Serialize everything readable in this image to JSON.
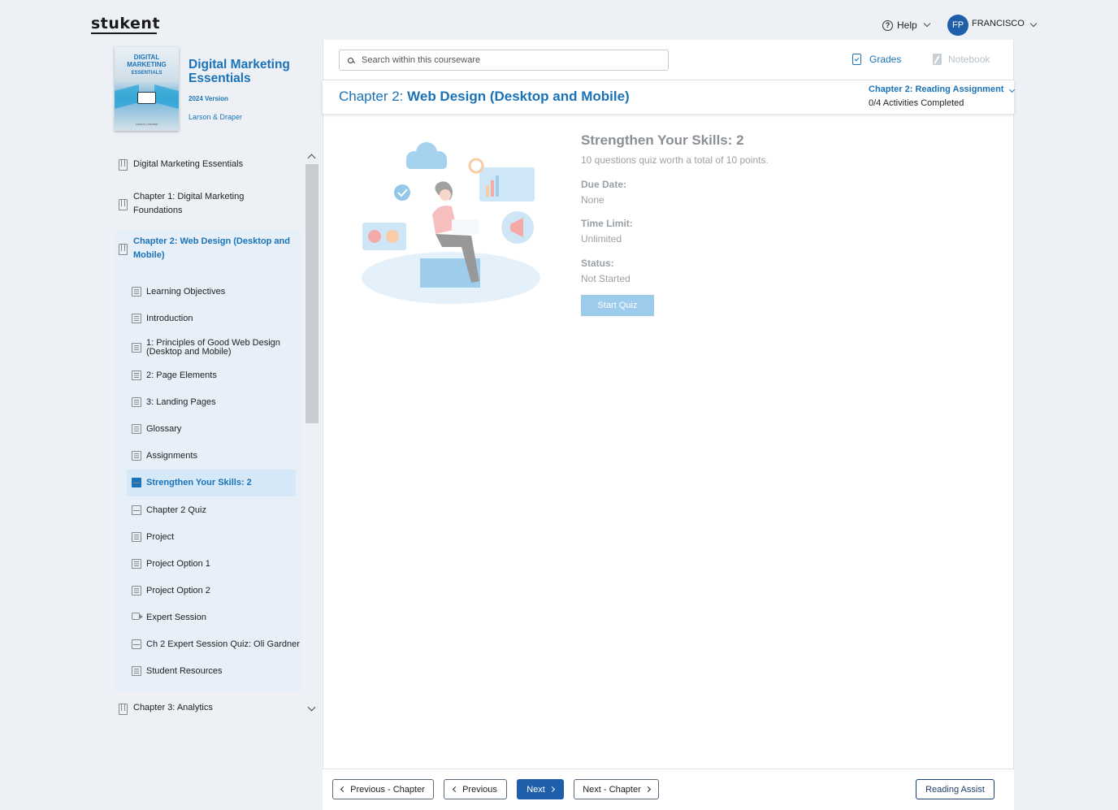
{
  "brand": {
    "logo": "stukent"
  },
  "topbar": {
    "help_label": "Help",
    "avatar_initials": "FP",
    "user_name": "FRANCISCO"
  },
  "book": {
    "cover_title": "DIGITAL MARKETING",
    "cover_subtitle": "ESSENTIALS",
    "title": "Digital Marketing Essentials",
    "version": "2024 Version",
    "author": "Larson & Draper",
    "cover_authors": "LARSON | DRAPER"
  },
  "sidebar": {
    "top": "Digital Marketing Essentials",
    "ch1": "Chapter 1: Digital Marketing Foundations",
    "ch2": "Chapter 2: Web Design (Desktop and Mobile)",
    "ch3": "Chapter 3: Analytics",
    "items": [
      {
        "label": "Learning Objectives",
        "icon": "document-icon"
      },
      {
        "label": "Introduction",
        "icon": "document-icon"
      },
      {
        "label": "1: Principles of Good Web Design (Desktop and Mobile)",
        "icon": "document-icon"
      },
      {
        "label": "2: Page Elements",
        "icon": "document-icon"
      },
      {
        "label": "3: Landing Pages",
        "icon": "document-icon"
      },
      {
        "label": "Glossary",
        "icon": "document-icon"
      },
      {
        "label": "Assignments",
        "icon": "document-icon"
      },
      {
        "label": "Strengthen Your Skills: 2",
        "icon": "quiz-icon",
        "active": true
      },
      {
        "label": "Chapter 2 Quiz",
        "icon": "quiz-icon"
      },
      {
        "label": "Project",
        "icon": "document-icon"
      },
      {
        "label": "Project Option 1",
        "icon": "document-icon"
      },
      {
        "label": "Project Option 2",
        "icon": "document-icon"
      },
      {
        "label": "Expert Session",
        "icon": "video-icon"
      },
      {
        "label": "Ch 2 Expert Session Quiz: Oli Gardner",
        "icon": "quiz-icon"
      },
      {
        "label": "Student Resources",
        "icon": "document-icon"
      }
    ]
  },
  "search": {
    "placeholder": "Search within this courseware"
  },
  "toolbar": {
    "grades": "Grades",
    "notebook": "Notebook"
  },
  "chapter": {
    "prefix": "Chapter 2:",
    "name": "Web Design (Desktop and Mobile)",
    "assignment": "Chapter 2: Reading Assignment",
    "completed": "0/4 Activities Completed"
  },
  "quiz": {
    "title": "Strengthen Your Skills: 2",
    "description": "10 questions quiz worth a total of 10 points.",
    "due_label": "Due Date:",
    "due_value": "None",
    "time_label": "Time Limit:",
    "time_value": "Unlimited",
    "status_label": "Status:",
    "status_value": "Not Started",
    "start": "Start Quiz"
  },
  "footer": {
    "prev_chapter": "Previous - Chapter",
    "prev": "Previous",
    "next": "Next",
    "next_chapter": "Next - Chapter",
    "reading_assist": "Reading Assist"
  },
  "colors": {
    "accent": "#1a73b8",
    "primary_button": "#1f5ea8",
    "active_bg": "#d5e8f8"
  }
}
